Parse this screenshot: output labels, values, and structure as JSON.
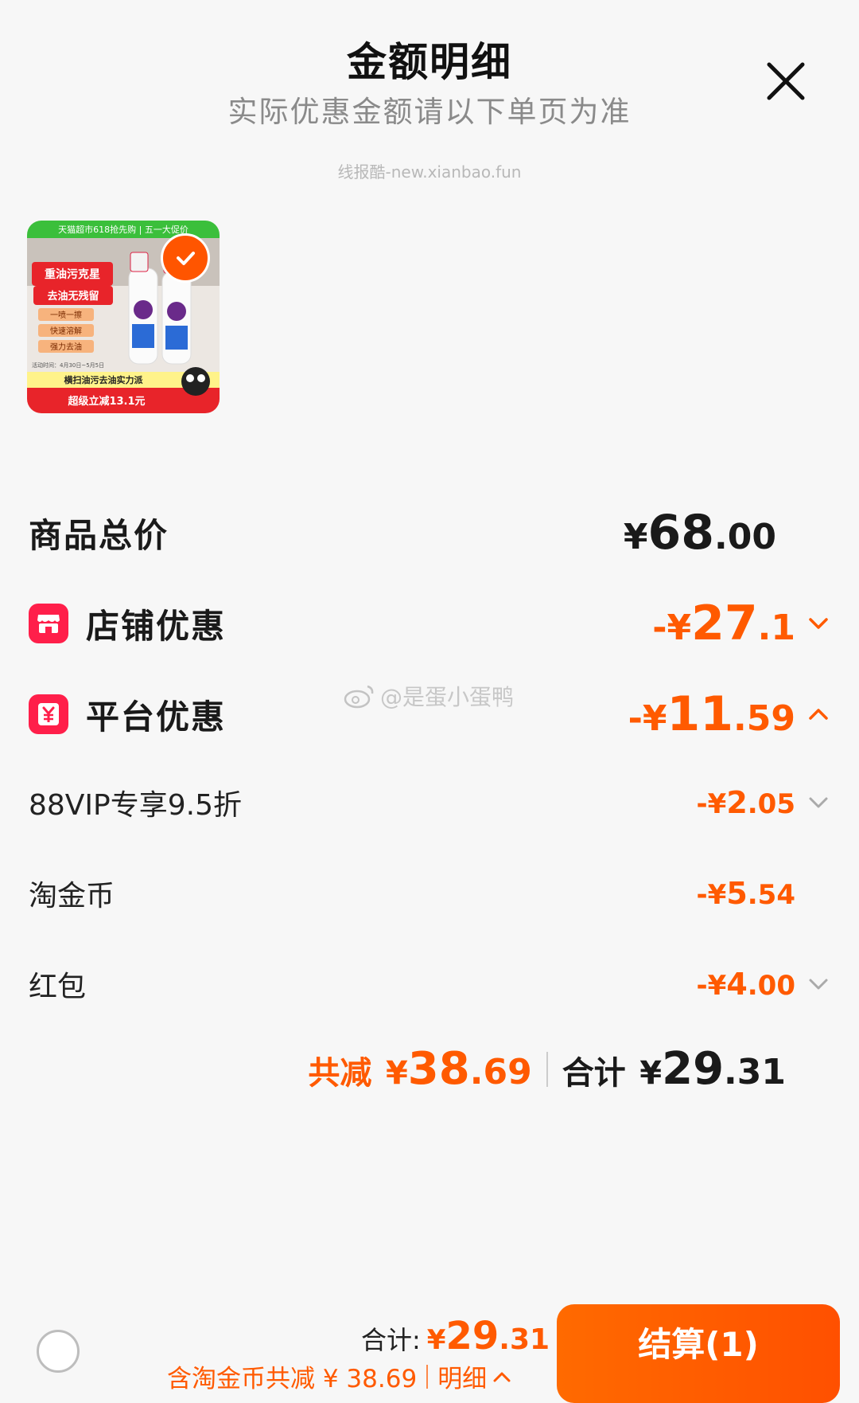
{
  "header": {
    "title": "金额明细",
    "subtitle": "实际优惠金额请以下单页为准",
    "watermark": "线报酷-new.xianbao.fun"
  },
  "product": {
    "image_texts": {
      "banner": "天猫超市618抢先购 | 五一大促价",
      "headline_1": "重油污克星",
      "headline_2": "去油无残留",
      "feature_1": "一喷一擦",
      "feature_2": "快速溶解",
      "feature_3": "强力去油",
      "period": "活动时间：4月30日~5月5日",
      "slogan": "横扫油污去油实力派",
      "deal": "超级立减13.1元"
    },
    "selected": true,
    "check_color": "#ff5500"
  },
  "rows": {
    "total": {
      "label": "商品总价",
      "currency": "¥",
      "int": "68",
      "dec": ".00"
    },
    "shop": {
      "label": "店铺优惠",
      "icon": "shop-icon",
      "prefix": "-¥",
      "int": "27",
      "dec": ".1",
      "chevron": "down"
    },
    "platform": {
      "label": "平台优惠",
      "icon": "yuan-coupon-icon",
      "prefix": "-¥",
      "int": "11",
      "dec": ".59",
      "chevron": "up"
    },
    "vip": {
      "label": "88VIP专享9.5折",
      "prefix": "-¥",
      "int": "2",
      "dec": ".05",
      "chevron": "down"
    },
    "coin": {
      "label": "淘金币",
      "prefix": "-¥",
      "int": "5",
      "dec": ".54"
    },
    "redpacket": {
      "label": "红包",
      "prefix": "-¥",
      "int": "4",
      "dec": ".00",
      "chevron": "down"
    }
  },
  "weibo_watermark": "@是蛋小蛋鸭",
  "summary": {
    "reduce_label": "共减",
    "reduce_currency": "¥",
    "reduce_int": "38",
    "reduce_dec": ".69",
    "total_label": "合计",
    "total_currency": "¥",
    "total_int": "29",
    "total_dec": ".31"
  },
  "bottom_bar": {
    "total_label": "合计:",
    "currency": "¥",
    "total_int": "29",
    "total_dec": ".31",
    "note": "含淘金币共减 ¥ 38.69",
    "detail_label": "明细",
    "checkout_label": "结算(1)"
  },
  "colors": {
    "accent": "#ff5a00",
    "badge": "#ff1f4a",
    "text_dark": "#1a1a1a",
    "subtitle_gray": "#8a8a8a"
  }
}
